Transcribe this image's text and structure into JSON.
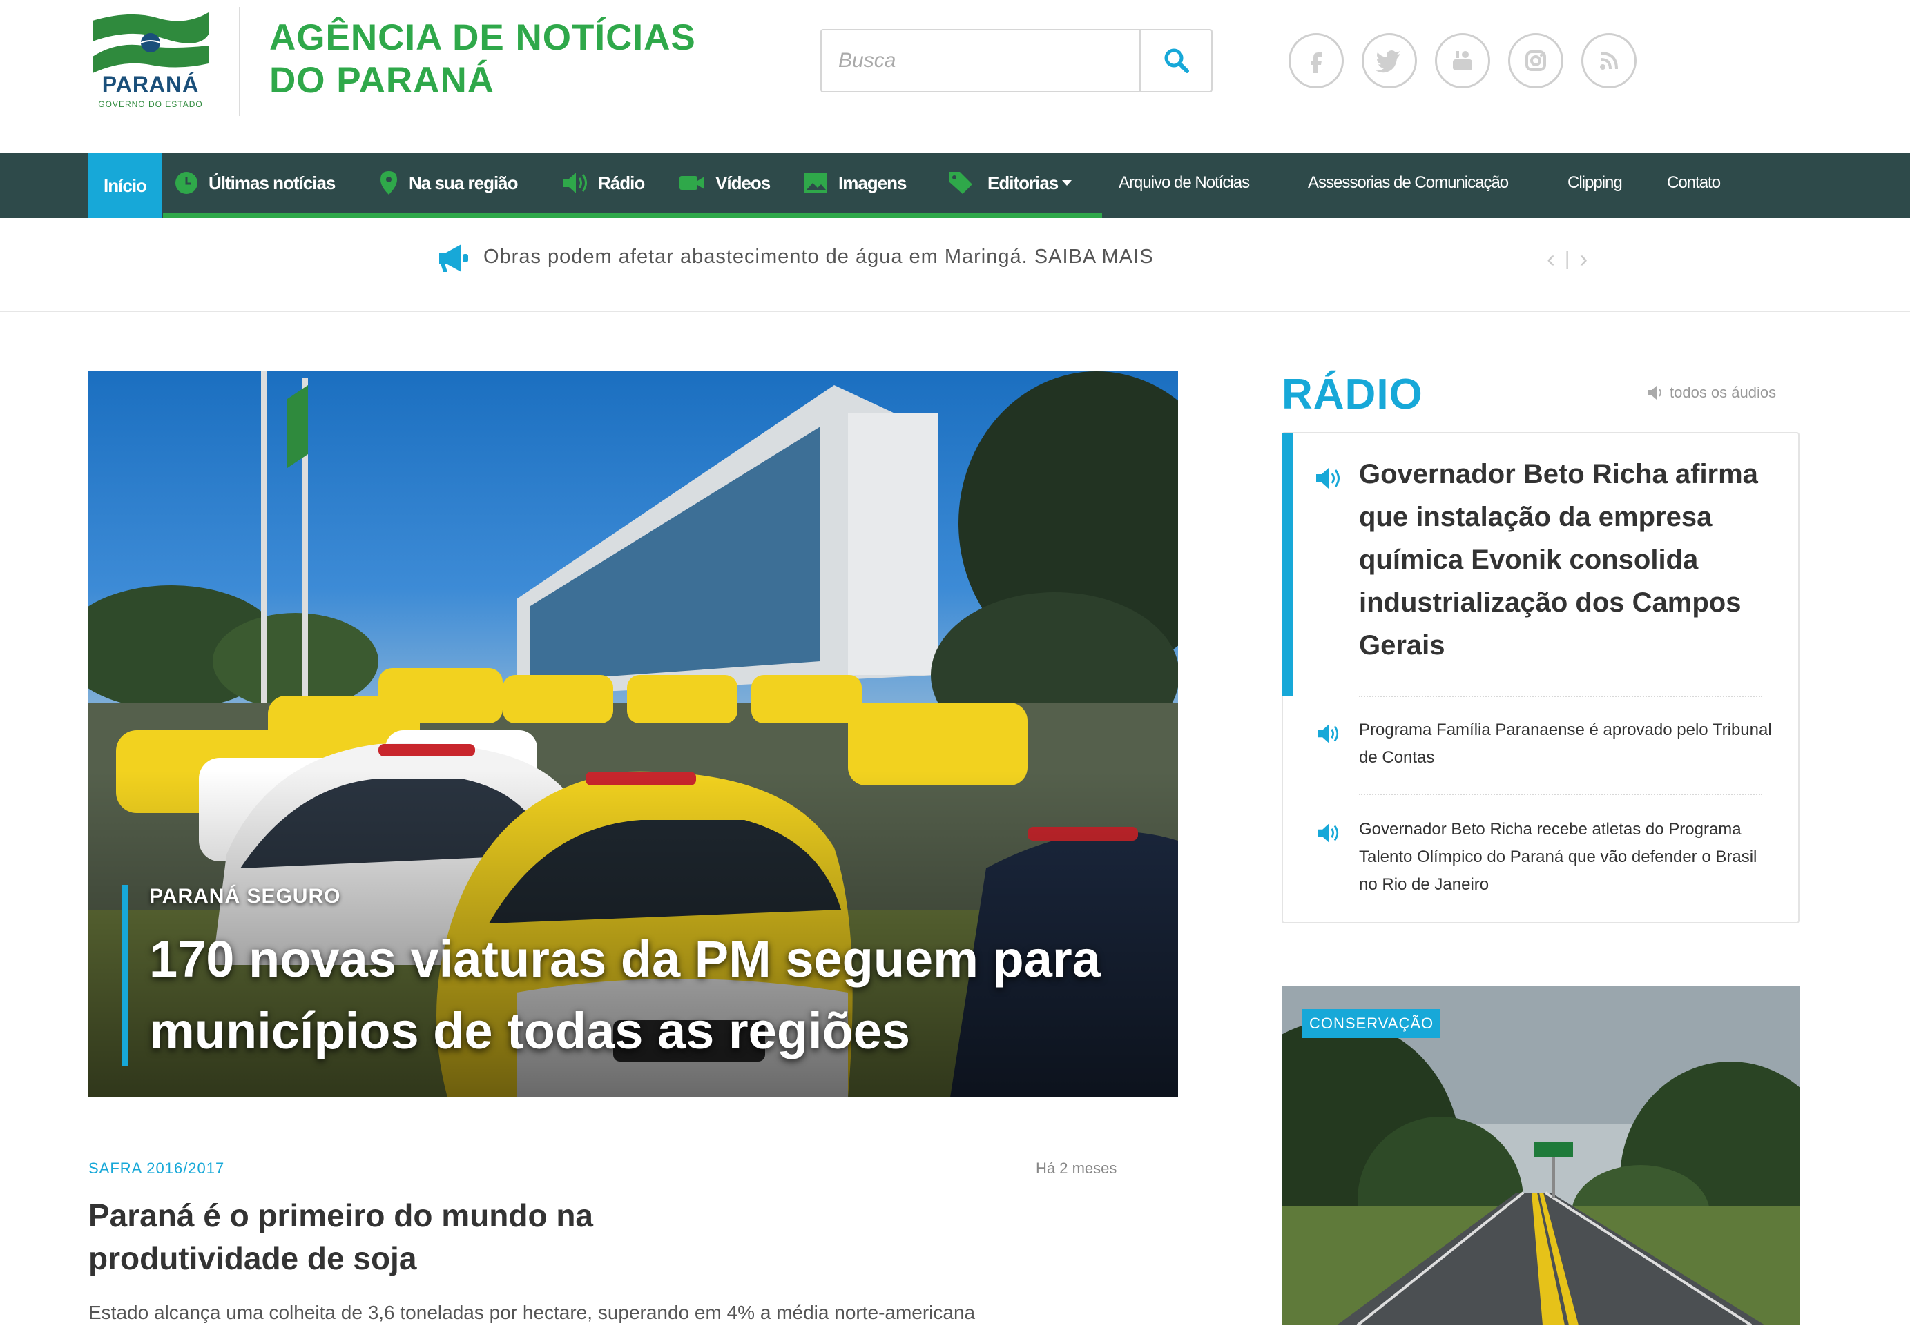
{
  "header": {
    "logo_text": "PARANÁ",
    "logo_sub": "GOVERNO DO ESTADO",
    "site_title_line1": "AGÊNCIA DE NOTÍCIAS",
    "site_title_line2": "DO PARANÁ",
    "search": {
      "placeholder": "Busca"
    },
    "socials": [
      "facebook-icon",
      "twitter-icon",
      "youtube-icon",
      "instagram-icon",
      "rss-icon"
    ]
  },
  "nav": {
    "items": [
      {
        "label": "Início"
      },
      {
        "label": "Últimas notícias"
      },
      {
        "label": "Na sua região"
      },
      {
        "label": "Rádio"
      },
      {
        "label": "Vídeos"
      },
      {
        "label": "Imagens"
      },
      {
        "label": "Editorias"
      },
      {
        "label": "Arquivo de Notícias"
      },
      {
        "label": "Assessorias de Comunicação"
      },
      {
        "label": "Clipping"
      },
      {
        "label": "Contato"
      }
    ]
  },
  "ticker": {
    "text": "Obras podem afetar abastecimento de água em Maringá. SAIBA MAIS",
    "prev": "‹",
    "sep": "|",
    "next": "›"
  },
  "hero": {
    "category": "PARANÁ SEGURO",
    "title": "170 novas viaturas da PM seguem para municípios de todas as regiões"
  },
  "article": {
    "category": "SAFRA 2016/2017",
    "time": "Há 2 meses",
    "title": "Paraná é o primeiro do mundo na produtividade de soja",
    "desc": "Estado alcança uma colheita de 3,6 toneladas por hectare, superando em 4% a média norte-americana"
  },
  "radio": {
    "heading": "RÁDIO",
    "all_label": "todos os áudios",
    "items": [
      {
        "title": "Governador Beto Richa afirma que instalação da empresa química Evonik consolida industrialização dos Campos Gerais"
      },
      {
        "title": "Programa Família Paranaense é aprovado pelo Tribunal de Contas"
      },
      {
        "title": "Governador Beto Richa recebe atletas do Programa Talento Olímpico do Paraná que vão defender o Brasil no Rio de Janeiro"
      }
    ]
  },
  "side": {
    "tag": "CONSERVAÇÃO"
  },
  "colors": {
    "accent": "#17a8d8",
    "brand_green": "#2fa84a",
    "nav_bg": "#2e4a4a"
  }
}
